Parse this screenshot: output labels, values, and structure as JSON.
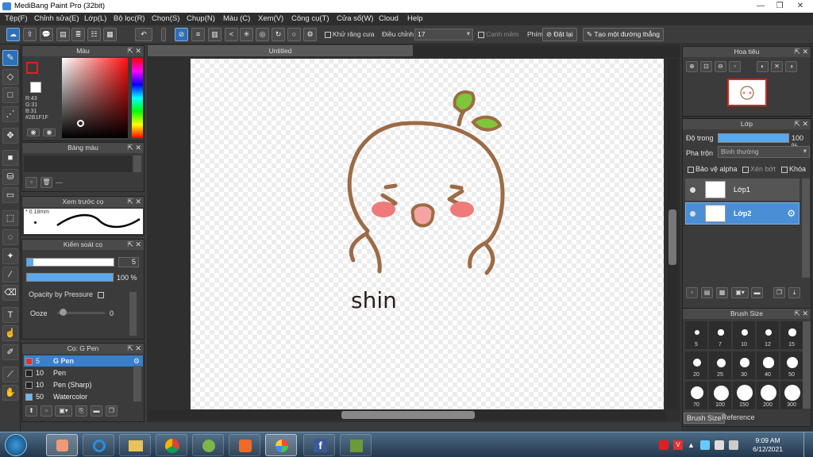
{
  "window": {
    "title": "MediBang Paint Pro (32bit)",
    "min": "—",
    "max": "❐",
    "close": "✕"
  },
  "menu": [
    "Tệp(F)",
    "Chỉnh sửa(E)",
    "Lớp(L)",
    "Bộ lọc(R)",
    "Chọn(S)",
    "Chụp(N)",
    "Màu (C)",
    "Xem(V)",
    "Công cụ(T)",
    "Cửa sổ(W)",
    "Cloud",
    "Help"
  ],
  "toolbar": {
    "antialias": "Khử răng cưa",
    "adjust": "Điều chỉnh",
    "adjust_value": "17",
    "edge": "Cạnh mềm",
    "phim": "Phím",
    "reset": "Đặt lại",
    "make_line": "Tạo một đường thẳng"
  },
  "panels": {
    "color": {
      "title": "Màu",
      "r": "R:43",
      "g": "G:31",
      "b": "B:31",
      "hex": "#2B1F1F",
      "current": "#2b1f1f"
    },
    "palette": {
      "title": "Bảng màu",
      "empty": "---"
    },
    "brush_preview": {
      "title": "Xem trước cọ",
      "size": "0.18mm"
    },
    "brush_control": {
      "title": "Kiểm soát cọ",
      "size_value": "5",
      "opacity_value": "100",
      "opacity_unit": "%",
      "opacity_by_pressure": "Opacity by Pressure",
      "ooze": "Ooze",
      "ooze_value": "0"
    },
    "brush_list": {
      "title": "Cọ: G Pen",
      "items": [
        {
          "size": "5",
          "name": "G Pen",
          "color": "#e03030"
        },
        {
          "size": "10",
          "name": "Pen",
          "color": "#222222"
        },
        {
          "size": "10",
          "name": "Pen (Sharp)",
          "color": "#222222"
        },
        {
          "size": "50",
          "name": "Watercolor",
          "color": "#6ab8f0"
        }
      ]
    }
  },
  "canvas": {
    "tab": "Untitled",
    "signature": "shin"
  },
  "navigator": {
    "title": "Hoa tiêu"
  },
  "layers": {
    "title": "Lớp",
    "opacity_label": "Độ trong",
    "opacity_value": "100",
    "opacity_unit": "%",
    "blend_label": "Pha trộn",
    "blend_value": "Bình thường",
    "protect_alpha": "Bảo vệ alpha",
    "clip": "Xén bớt",
    "lock": "Khóa",
    "items": [
      {
        "name": "Lớp1"
      },
      {
        "name": "Lớp2"
      }
    ]
  },
  "brush_size": {
    "title": "Brush Size",
    "sizes": [
      "5",
      "7",
      "10",
      "12",
      "15",
      "20",
      "25",
      "30",
      "40",
      "50",
      "70",
      "100",
      "150",
      "200",
      "300"
    ],
    "tabs": [
      "Brush Size",
      "Reference"
    ]
  },
  "taskbar": {
    "time": "9:09 AM",
    "date": "6/12/2021"
  }
}
